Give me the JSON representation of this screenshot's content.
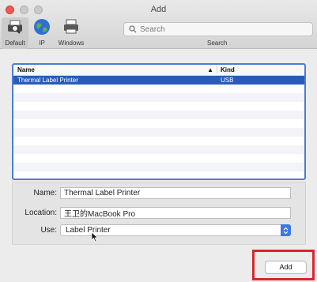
{
  "window": {
    "title": "Add"
  },
  "toolbar": {
    "default_label": "Default",
    "ip_label": "IP",
    "windows_label": "Windows",
    "search_placeholder": "Search",
    "search_label": "Search"
  },
  "list": {
    "columns": {
      "name": "Name",
      "kind": "Kind"
    },
    "rows": [
      {
        "name": "Thermal Label Printer",
        "kind": "USB",
        "selected": true
      }
    ]
  },
  "form": {
    "name_label": "Name:",
    "name_value": "Thermal Label Printer",
    "location_label": "Location:",
    "location_value": "王卫的MacBook Pro",
    "use_label": "Use:",
    "use_value": "Label Printer"
  },
  "actions": {
    "add_label": "Add"
  },
  "colors": {
    "selection": "#2a5bb7",
    "highlight": "#d9262b",
    "accent": "#3b78e7"
  }
}
